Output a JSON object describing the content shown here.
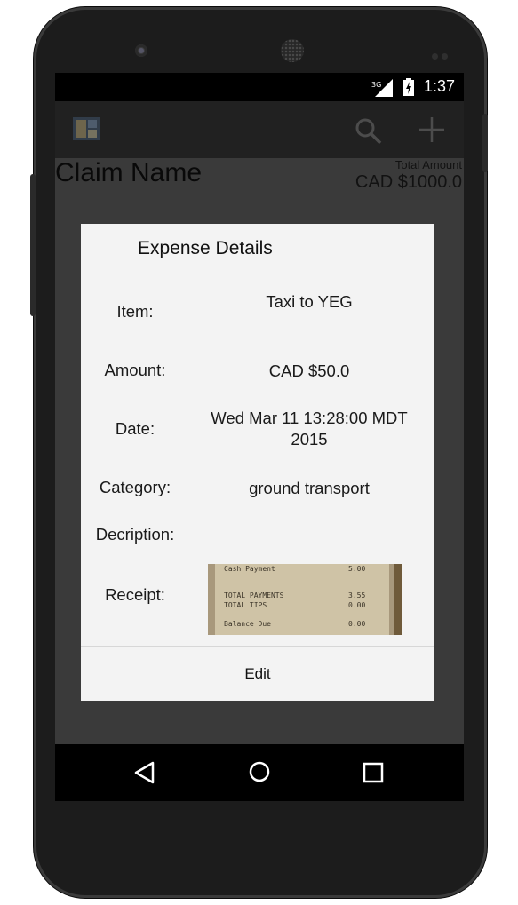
{
  "status_bar": {
    "time": "1:37",
    "network": "3G"
  },
  "app": {
    "claim_name": "Claim Name",
    "total_label": "Total Amount",
    "total_value": "CAD $1000.0"
  },
  "dialog": {
    "title": "Expense Details",
    "fields": {
      "item_label": "Item:",
      "item_value": "Taxi to YEG",
      "amount_label": "Amount:",
      "amount_value": "CAD $50.0",
      "date_label": "Date:",
      "date_value": "Wed Mar 11 13:28:00 MDT 2015",
      "category_label": "Category:",
      "category_value": "ground transport",
      "description_label": "Decription:",
      "description_value": "",
      "receipt_label": "Receipt:"
    },
    "receipt_lines": {
      "l1_left": "Cash Payment",
      "l1_right": "5.00",
      "l2_left": "TOTAL PAYMENTS",
      "l2_right": "3.55",
      "l3_left": "TOTAL TIPS",
      "l3_right": "0.00",
      "l4_left": "Balance Due",
      "l4_right": "0.00"
    },
    "edit_label": "Edit"
  },
  "icons": {
    "app_icon": "app-icon",
    "search": "search-icon",
    "add": "plus-icon",
    "back": "back-icon",
    "home": "home-icon",
    "recent": "recent-apps-icon"
  }
}
